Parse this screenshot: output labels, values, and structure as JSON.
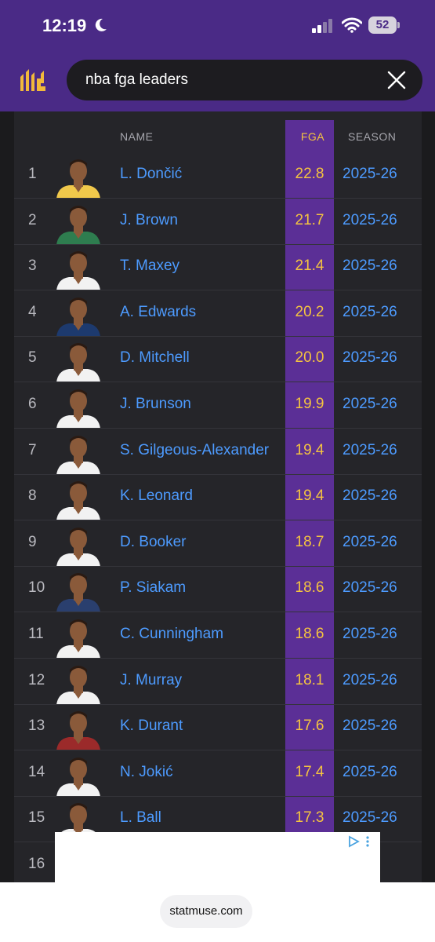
{
  "status_bar": {
    "time": "12:19",
    "battery": "52"
  },
  "search": {
    "query": "nba fga leaders"
  },
  "table": {
    "headers": {
      "name": "NAME",
      "fga": "FGA",
      "season": "SEASON"
    },
    "rows": [
      {
        "rank": "1",
        "name": "L. Dončić",
        "fga": "22.8",
        "season": "2025-26",
        "jersey": "#f0c84b"
      },
      {
        "rank": "2",
        "name": "J. Brown",
        "fga": "21.7",
        "season": "2025-26",
        "jersey": "#2e7d4f"
      },
      {
        "rank": "3",
        "name": "T. Maxey",
        "fga": "21.4",
        "season": "2025-26",
        "jersey": "#f2f2f2"
      },
      {
        "rank": "4",
        "name": "A. Edwards",
        "fga": "20.2",
        "season": "2025-26",
        "jersey": "#1d3a6e"
      },
      {
        "rank": "5",
        "name": "D. Mitchell",
        "fga": "20.0",
        "season": "2025-26",
        "jersey": "#f2f2f2"
      },
      {
        "rank": "6",
        "name": "J. Brunson",
        "fga": "19.9",
        "season": "2025-26",
        "jersey": "#f2f2f2"
      },
      {
        "rank": "7",
        "name": "S. Gilgeous-Alexander",
        "fga": "19.4",
        "season": "2025-26",
        "jersey": "#f2f2f2"
      },
      {
        "rank": "8",
        "name": "K. Leonard",
        "fga": "19.4",
        "season": "2025-26",
        "jersey": "#f2f2f2"
      },
      {
        "rank": "9",
        "name": "D. Booker",
        "fga": "18.7",
        "season": "2025-26",
        "jersey": "#f2f2f2"
      },
      {
        "rank": "10",
        "name": "P. Siakam",
        "fga": "18.6",
        "season": "2025-26",
        "jersey": "#2a3f6e"
      },
      {
        "rank": "11",
        "name": "C. Cunningham",
        "fga": "18.6",
        "season": "2025-26",
        "jersey": "#f2f2f2"
      },
      {
        "rank": "12",
        "name": "J. Murray",
        "fga": "18.1",
        "season": "2025-26",
        "jersey": "#f2f2f2"
      },
      {
        "rank": "13",
        "name": "K. Durant",
        "fga": "17.6",
        "season": "2025-26",
        "jersey": "#9b2a2a"
      },
      {
        "rank": "14",
        "name": "N. Jokić",
        "fga": "17.4",
        "season": "2025-26",
        "jersey": "#f2f2f2"
      },
      {
        "rank": "15",
        "name": "L. Ball",
        "fga": "17.3",
        "season": "2025-26",
        "jersey": "#f2f2f2"
      },
      {
        "rank": "16",
        "name": "",
        "fga": "",
        "season": "-26",
        "jersey": "#f2f2f2"
      }
    ]
  },
  "footer": {
    "url": "statmuse.com"
  },
  "colors": {
    "header": "#4a2a86",
    "fga_column": "#5b2f96",
    "link_blue": "#4d9bff",
    "fga_gold": "#f4c340"
  }
}
